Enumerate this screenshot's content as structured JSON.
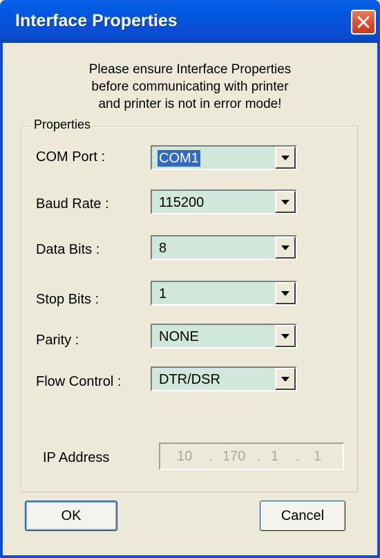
{
  "window": {
    "title": "Interface Properties"
  },
  "notice": {
    "line1": "Please ensure Interface Properties",
    "line2": "before communicating with printer",
    "line3": "and printer is not in error mode!"
  },
  "properties": {
    "group_label": "Properties",
    "com_port": {
      "label": "COM Port :",
      "value": "COM1"
    },
    "baud_rate": {
      "label": "Baud Rate :",
      "value": "115200"
    },
    "data_bits": {
      "label": "Data Bits :",
      "value": "8"
    },
    "stop_bits": {
      "label": "Stop Bits :",
      "value": "1"
    },
    "parity": {
      "label": "Parity :",
      "value": "NONE"
    },
    "flow_control": {
      "label": "Flow Control :",
      "value": "DTR/DSR"
    },
    "ip_address": {
      "label": "IP Address",
      "octets": [
        "10",
        "170",
        "1",
        "1"
      ]
    }
  },
  "buttons": {
    "ok": "OK",
    "cancel": "Cancel"
  },
  "colors": {
    "title_bar": "#0058e0",
    "combo_bg": "#cfe8d9",
    "selection": "#316ac5"
  }
}
